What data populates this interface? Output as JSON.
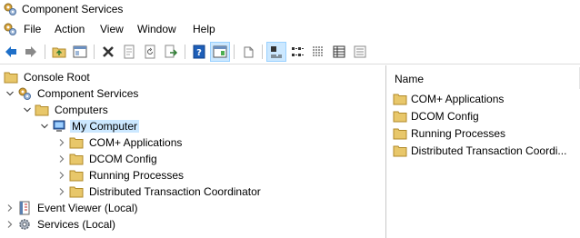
{
  "window": {
    "title": "Component Services"
  },
  "menu": {
    "items": [
      "File",
      "Action",
      "View",
      "Window",
      "Help"
    ]
  },
  "toolbar": {
    "buttons": [
      "back-arrow-icon",
      "forward-arrow-icon",
      "up-folder-icon",
      "show-hide-tree-icon",
      "delete-icon",
      "properties-icon",
      "refresh-icon",
      "export-list-icon",
      "help-icon",
      "show-hide-action-pane-icon",
      "new-window-icon",
      "large-icons-view-icon",
      "small-icons-view-icon",
      "list-view-icon",
      "detail-view-icon",
      "configure-my-computer-icon"
    ]
  },
  "tree": {
    "root": "Console Root",
    "component_services": "Component Services",
    "computers": "Computers",
    "my_computer": "My Computer",
    "children": [
      "COM+ Applications",
      "DCOM Config",
      "Running Processes",
      "Distributed Transaction Coordinator"
    ],
    "event_viewer": "Event Viewer (Local)",
    "services": "Services (Local)"
  },
  "list": {
    "column": "Name",
    "items": [
      "COM+ Applications",
      "DCOM Config",
      "Running Processes",
      "Distributed Transaction Coordi..."
    ]
  },
  "colors": {
    "folder": "#e8c76a",
    "selection": "#cce8ff",
    "toolbar_blue": "#1e6fc8"
  }
}
